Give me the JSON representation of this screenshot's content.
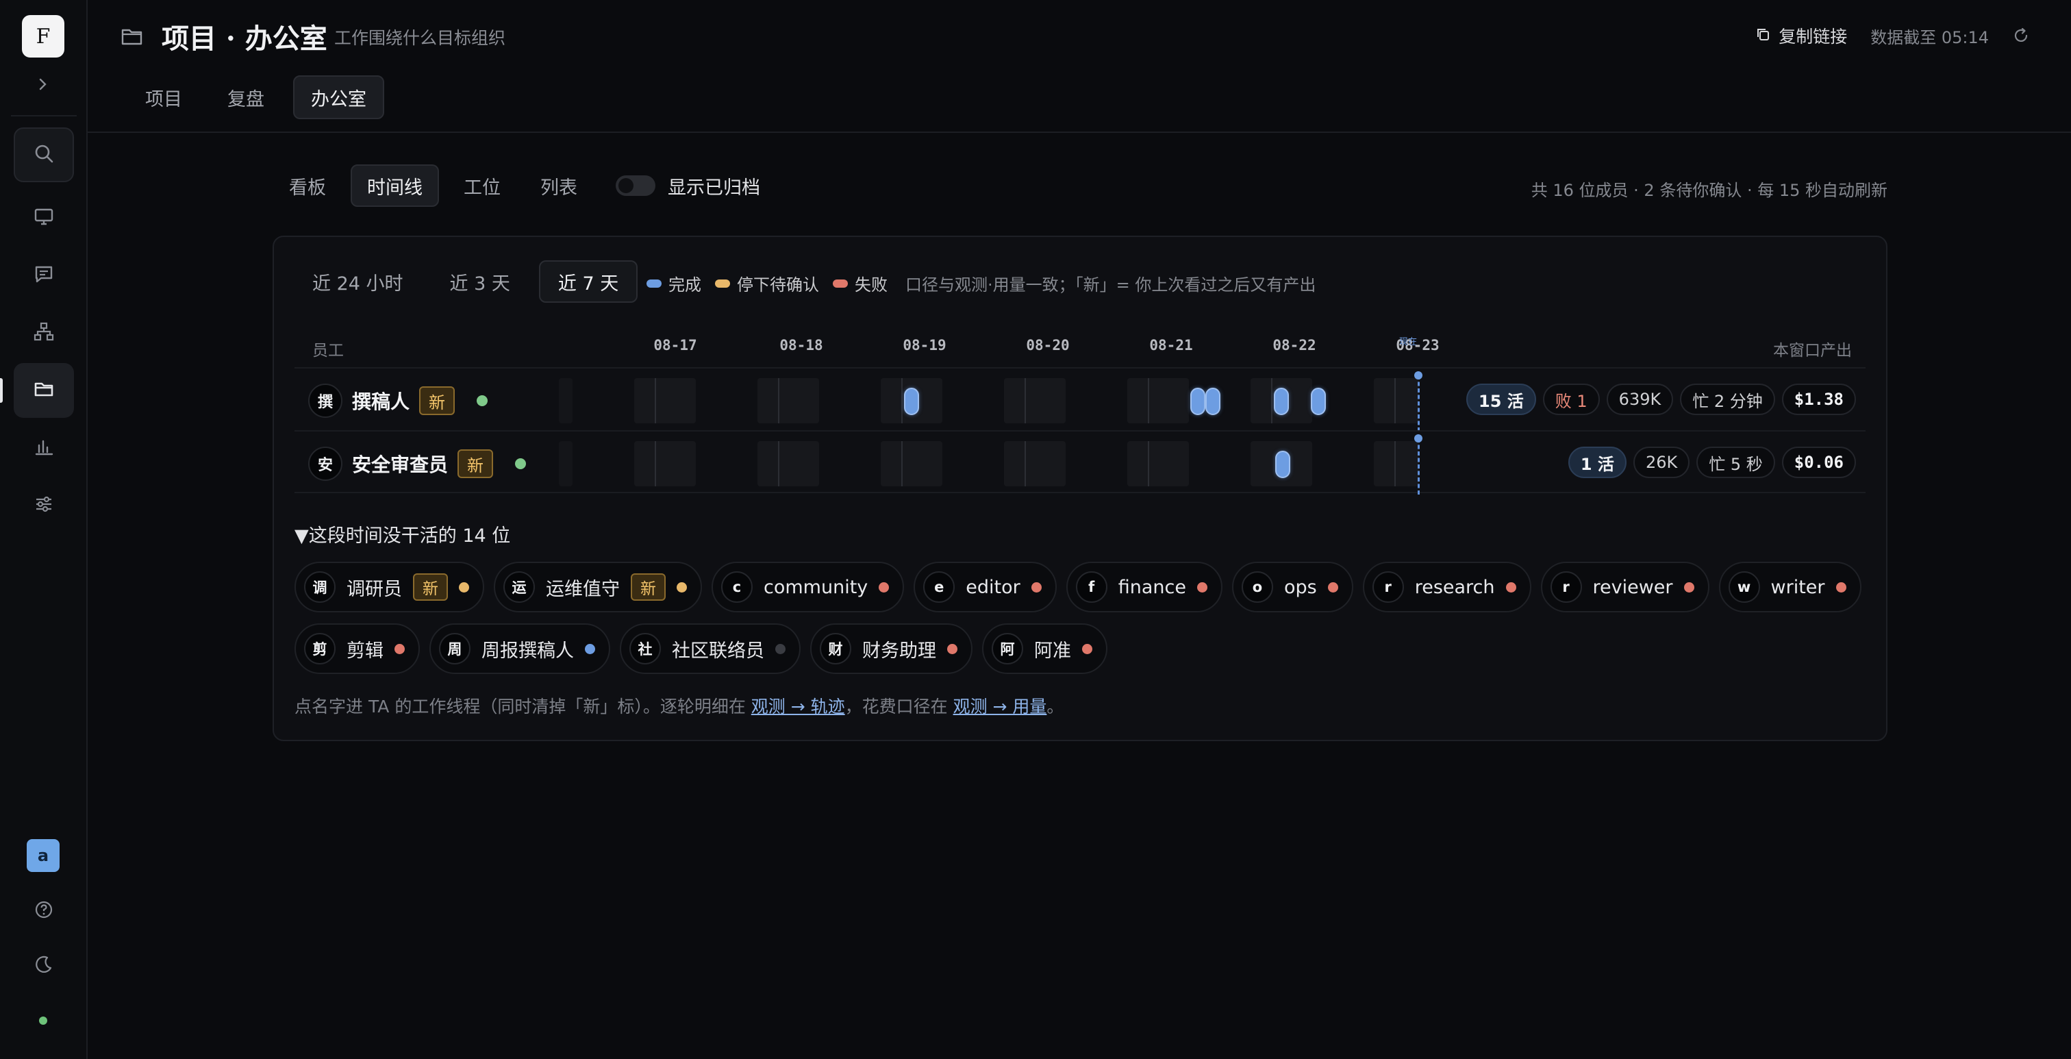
{
  "sidebar": {
    "logo": "F",
    "avatar": "a",
    "nav": [
      "search-icon",
      "monitor-icon",
      "chat-icon",
      "org-chart-icon",
      "folder-icon",
      "bar-chart-icon",
      "sliders-icon"
    ],
    "bottom": [
      "help-icon",
      "moon-icon"
    ]
  },
  "header": {
    "title": "项目 · 办公室",
    "subtitle": "工作围绕什么目标组织",
    "copy_link": "复制链接",
    "updated": "数据截至 05:14",
    "tabs": [
      "项目",
      "复盘",
      "办公室"
    ],
    "active_tab": "办公室"
  },
  "view": {
    "tabs": [
      "看板",
      "时间线",
      "工位",
      "列表"
    ],
    "active": "时间线",
    "show_archived": "显示已归档",
    "summary": "共 16 位成员 · 2 条待你确认 · 每 15 秒自动刷新"
  },
  "timeline": {
    "ranges": [
      "近 24 小时",
      "近 3 天",
      "近 7 天"
    ],
    "active_range": "近 7 天",
    "legend": [
      {
        "label": "完成",
        "color": "#6d9de2"
      },
      {
        "label": "停下待确认",
        "color": "#e8b86a"
      },
      {
        "label": "失败",
        "color": "#e0786a"
      }
    ],
    "legend_note": "口径与观测·用量一致；「新」= 你上次看过之后又有产出",
    "col_employee": "员工",
    "col_output": "本窗口产出",
    "dates": [
      "08-17",
      "08-18",
      "08-19",
      "08-20",
      "08-21",
      "08-22",
      "08-23"
    ],
    "now_label": "现在",
    "rows": [
      {
        "avatar": "撰",
        "name": "撰稿人",
        "badge": "新",
        "stats": {
          "runs": "15 活",
          "fail": "败 1",
          "tokens": "639K",
          "busy": "忙 2 分钟",
          "cost": "$1.38"
        }
      },
      {
        "avatar": "安",
        "name": "安全审查员",
        "badge": "新",
        "stats": {
          "runs": "1 活",
          "tokens": "26K",
          "busy": "忙 5 秒",
          "cost": "$0.06"
        }
      }
    ]
  },
  "idle": {
    "toggle": "▼这段时间没干活的 14 位",
    "members": [
      {
        "avatar": "调",
        "name": "调研员",
        "badge": "新",
        "dot": "#e8b86a"
      },
      {
        "avatar": "运",
        "name": "运维值守",
        "badge": "新",
        "dot": "#e8b86a"
      },
      {
        "avatar": "c",
        "name": "community",
        "dot": "#e0786a"
      },
      {
        "avatar": "e",
        "name": "editor",
        "dot": "#e0786a"
      },
      {
        "avatar": "f",
        "name": "finance",
        "dot": "#e0786a"
      },
      {
        "avatar": "o",
        "name": "ops",
        "dot": "#e0786a"
      },
      {
        "avatar": "r",
        "name": "research",
        "dot": "#e0786a"
      },
      {
        "avatar": "r",
        "name": "reviewer",
        "dot": "#e0786a"
      },
      {
        "avatar": "w",
        "name": "writer",
        "dot": "#e0786a"
      },
      {
        "avatar": "剪",
        "name": "剪辑",
        "dot": "#e0786a"
      },
      {
        "avatar": "周",
        "name": "周报撰稿人",
        "dot": "#6d9de2"
      },
      {
        "avatar": "社",
        "name": "社区联络员",
        "dot": "#3a3c42"
      },
      {
        "avatar": "财",
        "name": "财务助理",
        "dot": "#e0786a"
      },
      {
        "avatar": "阿",
        "name": "阿准",
        "dot": "#e0786a"
      }
    ],
    "foot_prefix": "点名字进 TA 的工作线程（同时清掉「新」标）。逐轮明细在 ",
    "foot_link1": "观测 → 轨迹",
    "foot_mid": "，花费口径在 ",
    "foot_link2": "观测 → 用量",
    "foot_suffix": "。"
  }
}
